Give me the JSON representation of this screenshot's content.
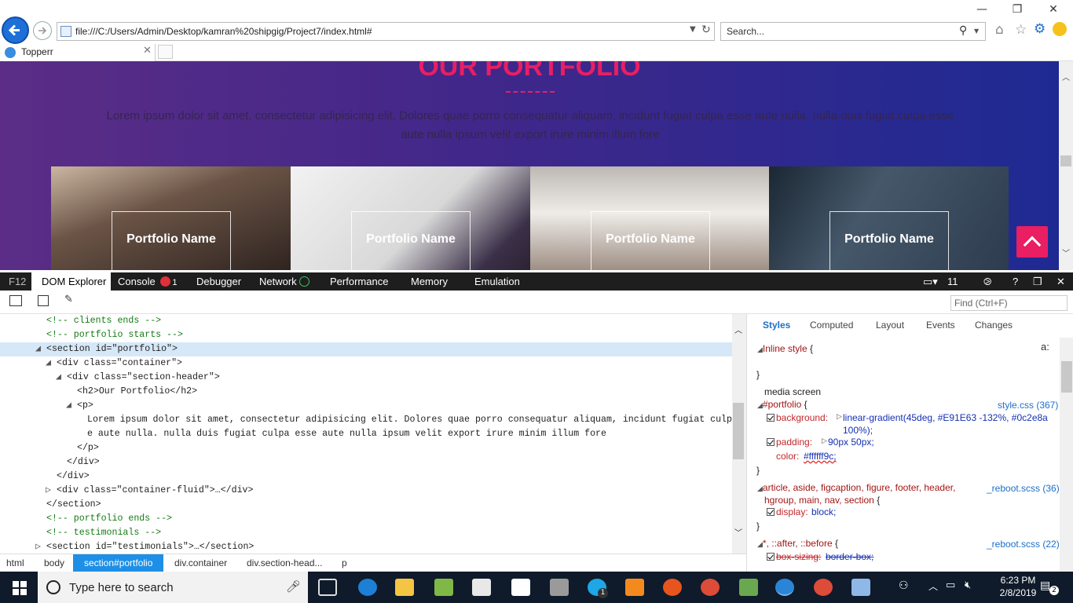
{
  "browser": {
    "url": "file:///C:/Users/Admin/Desktop/kamran%20shipgig/Project7/index.html#",
    "search_placeholder": "Search...",
    "tab_title": "Topperr"
  },
  "page": {
    "section_title": "OUR PORTFOLIO",
    "intro": "Lorem ipsum dolor sit amet, consectetur adipisicing elit. Dolores quae porro consequatur aliquam, incidunt fugiat culpa esse aute nulla. nulla duis fugiat culpa esse aute nulla ipsum velit export irure minim illum fore",
    "items": [
      {
        "caption": "Portfolio Name"
      },
      {
        "caption": "Portfolio Name"
      },
      {
        "caption": "Portfolio Name"
      },
      {
        "caption": "Portfolio Name"
      }
    ]
  },
  "devtools": {
    "f12": "F12",
    "tabs": {
      "dom": "DOM Explorer",
      "console": "Console",
      "console_errors": "1",
      "debugger": "Debugger",
      "network": "Network",
      "performance": "Performance",
      "memory": "Memory",
      "emulation": "Emulation"
    },
    "target_count": "11",
    "find_placeholder": "Find (Ctrl+F)",
    "dom_lines": [
      {
        "t": "<!-- clients ends -->"
      },
      {
        "t": "<!-- portfolio starts -->"
      },
      {
        "t": "<section id=\"portfolio\">"
      },
      {
        "t": "<div class=\"container\">"
      },
      {
        "t": "<div class=\"section-header\">"
      },
      {
        "t": "<h2>Our Portfolio</h2>"
      },
      {
        "t": "<p>"
      },
      {
        "t": "Lorem ipsum dolor sit amet, consectetur adipisicing elit. Dolores quae porro consequatur aliquam, incidunt fugiat culpa ess"
      },
      {
        "t": "e aute nulla. nulla duis fugiat culpa esse aute nulla ipsum velit export irure minim illum fore"
      },
      {
        "t": "</p>"
      },
      {
        "t": "</div>"
      },
      {
        "t": "</div>"
      },
      {
        "t": "<div class=\"container-fluid\">…</div>"
      },
      {
        "t": "</section>"
      },
      {
        "t": "<!-- portfolio ends -->"
      },
      {
        "t": "<!-- testimonials -->"
      },
      {
        "t": "<section id=\"testimonials\">…</section>"
      }
    ],
    "breadcrumbs": [
      "html",
      "body",
      "section#portfolio",
      "div.container",
      "div.section-head...",
      "p"
    ],
    "styles_tabs": [
      "Styles",
      "Computed",
      "Layout",
      "Events",
      "Changes"
    ],
    "styles": {
      "inline": "Inline style",
      "brace_open": "{",
      "brace_close": "}",
      "media": "media screen",
      "rule1_selector": "#portfolio",
      "rule1_source": "style.css (367)",
      "rule1_p1_name": "background:",
      "rule1_p1_value_a": "linear-gradient(45deg, #E91E63 -132%, #0c2e8a",
      "rule1_p1_value_b": "100%);",
      "rule1_p2_name": "padding:",
      "rule1_p2_value": "90px 50px;",
      "rule1_p3_name": "color:",
      "rule1_p3_value": "#ffffff9c;",
      "rule2_selector_a": "article, aside, figcaption, figure, footer, header,",
      "rule2_selector_b": "hgroup, main, nav, section",
      "rule2_source": "_reboot.scss (36)",
      "rule2_p1_name": "display:",
      "rule2_p1_value": "block;",
      "rule3_selector": "*, ::after, ::before",
      "rule3_source": "_reboot.scss (22)",
      "rule3_p1_name": "box-sizing:",
      "rule3_p1_value": "border-box;"
    }
  },
  "taskbar": {
    "search_placeholder": "Type here to search",
    "time": "6:23 PM",
    "date": "2/8/2019",
    "notifications": "2",
    "skype_badge": "1"
  },
  "colors": {
    "accent_pink": "#e91e63",
    "gradient_start": "#5b2d86",
    "gradient_end": "#1e2a92",
    "selection_blue": "#1e8fe6"
  }
}
